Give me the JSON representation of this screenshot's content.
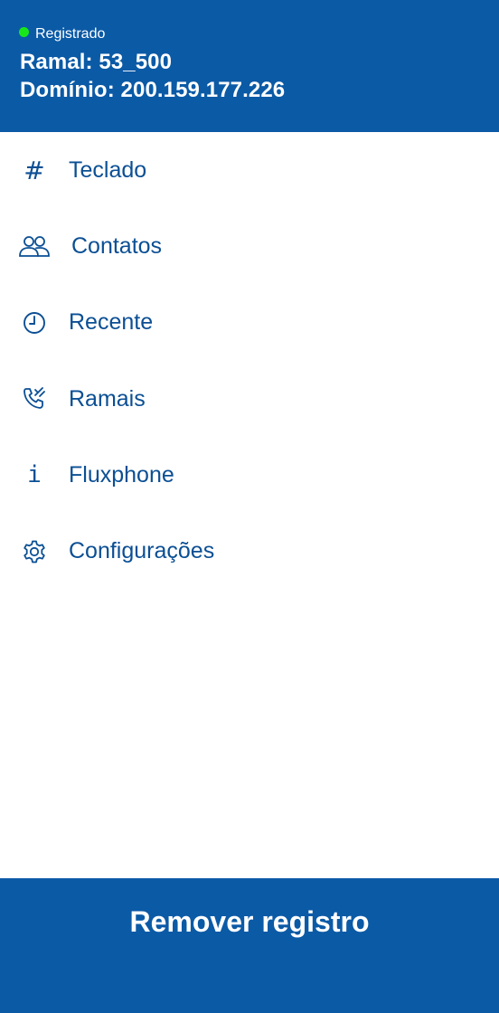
{
  "colors": {
    "header_background": "#0b5aa6",
    "accent_text": "#0b4f94",
    "status_dot": "#19e619",
    "background": "#ffffff"
  },
  "header": {
    "status": "Registrado",
    "ramal": "Ramal: 53_500",
    "dominio": "Domínio: 200.159.177.226"
  },
  "menu": {
    "items": [
      {
        "label": "Teclado",
        "icon": "hash-icon"
      },
      {
        "label": "Contatos",
        "icon": "people-icon"
      },
      {
        "label": "Recente",
        "icon": "clock-icon"
      },
      {
        "label": "Ramais",
        "icon": "phone-call-icon"
      },
      {
        "label": "Fluxphone",
        "icon": "info-icon"
      },
      {
        "label": "Configurações",
        "icon": "gear-icon"
      }
    ]
  },
  "footer": {
    "button_label": "Remover registro"
  }
}
